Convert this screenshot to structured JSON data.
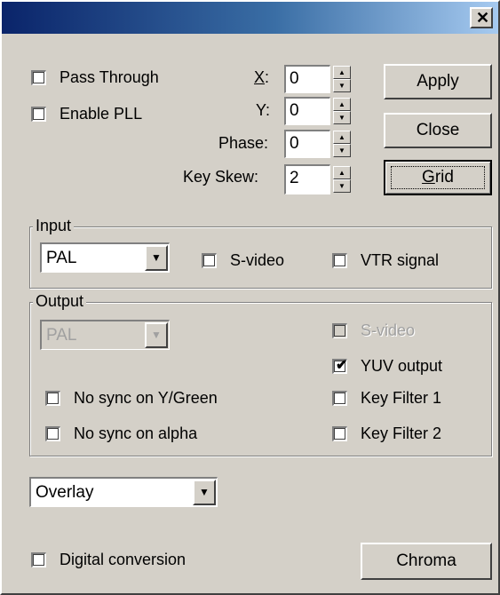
{
  "titlebar": {
    "close_glyph": "✕",
    "close_icon": "close-icon"
  },
  "options": {
    "pass_through": {
      "label": "Pass Through",
      "checked": false
    },
    "enable_pll": {
      "label": "Enable PLL",
      "checked": false
    }
  },
  "params": {
    "x": {
      "label_char": "X",
      "label_rest": ":",
      "value": "0"
    },
    "y": {
      "label": "Y:",
      "value": "0"
    },
    "phase": {
      "label": "Phase:",
      "value": "0"
    },
    "key_skew": {
      "label": "Key Skew:",
      "value": "2"
    }
  },
  "buttons": {
    "apply": "Apply",
    "close": "Close",
    "grid_char": "G",
    "grid_rest": "rid",
    "chroma": "Chroma"
  },
  "input": {
    "legend": "Input",
    "standard": "PAL",
    "svideo": {
      "label": "S-video",
      "checked": false
    },
    "vtr": {
      "label": "VTR signal",
      "checked": false
    }
  },
  "output": {
    "legend": "Output",
    "standard": "PAL",
    "svideo": {
      "label": "S-video",
      "checked": false,
      "enabled": false
    },
    "yuv": {
      "label": "YUV output",
      "checked": true
    },
    "nosync_y": {
      "label": "No sync on Y/Green",
      "checked": false
    },
    "nosync_alpha": {
      "label": "No sync on alpha",
      "checked": false
    },
    "keyfilter1": {
      "label": "Key Filter 1",
      "checked": false
    },
    "keyfilter2": {
      "label": "Key Filter 2",
      "checked": false
    }
  },
  "mode": {
    "value": "Overlay"
  },
  "digital": {
    "label": "Digital conversion",
    "checked": false
  },
  "check_mark": "✔",
  "arrows": {
    "up": "▲",
    "down": "▼"
  },
  "colors": {
    "title_start": "#0a246a",
    "title_end": "#a6caf0",
    "face": "#d4d0c8"
  }
}
